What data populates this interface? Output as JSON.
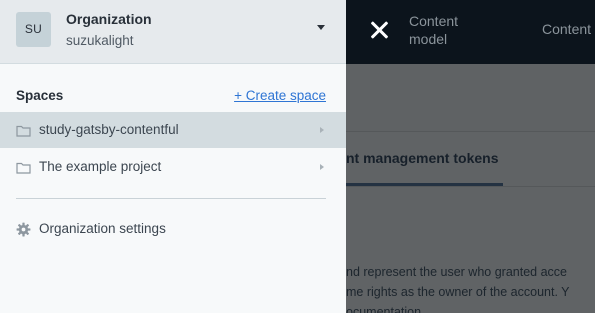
{
  "background": {
    "nav": {
      "close_icon": "close-icon",
      "content_model_label": "Content model",
      "content_label": "Content"
    },
    "tabs": {
      "active_tab_label": "nt management tokens"
    },
    "paragraph": {
      "line1": "nd represent the user who granted acce",
      "line2": "me rights as the owner of the account. Y",
      "line3": "ocumentation."
    }
  },
  "org_menu": {
    "avatar_initials": "SU",
    "org_name": "Organization",
    "org_subtitle": "suzukalight",
    "caret_icon": "caret-down-icon"
  },
  "spaces": {
    "heading": "Spaces",
    "create_label": "+ Create space",
    "items": [
      {
        "label": "study-gatsby-contentful",
        "icon": "folder-icon",
        "active": true
      },
      {
        "label": "The example project",
        "icon": "folder-icon",
        "active": false
      }
    ]
  },
  "settings": {
    "label": "Organization settings",
    "icon": "gear-icon"
  },
  "colors": {
    "topbar": "#0c141c",
    "panel": "#f7f9fa",
    "header": "#e6eaed",
    "active_row": "#d3dce0",
    "link": "#2e75d4",
    "overlay": "#606365"
  }
}
